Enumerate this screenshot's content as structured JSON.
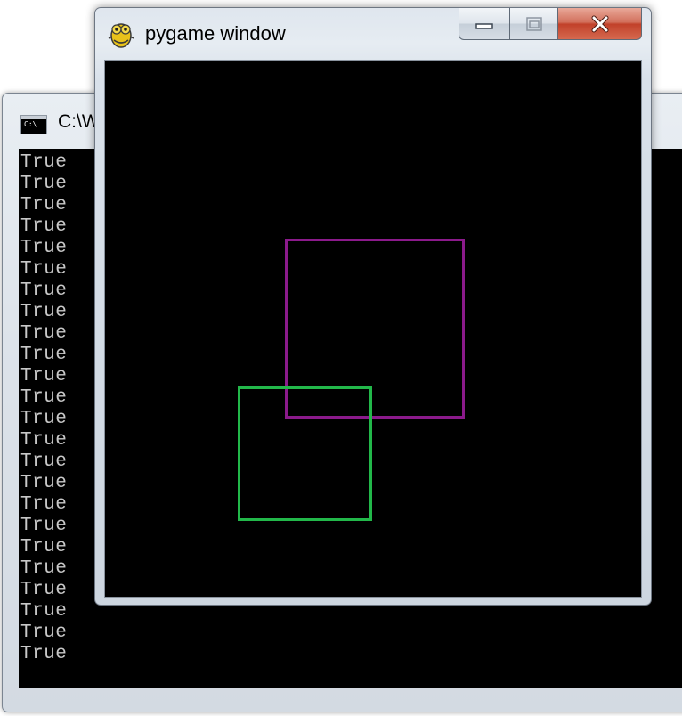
{
  "console": {
    "title": "C:\\W",
    "icon_label": "C:\\",
    "lines": [
      "True",
      "True",
      "True",
      "True",
      "True",
      "True",
      "True",
      "True",
      "True",
      "True",
      "True",
      "True",
      "True",
      "True",
      "True",
      "True",
      "True",
      "True",
      "True",
      "True",
      "True",
      "True",
      "True",
      "True"
    ]
  },
  "pygame": {
    "title": "pygame window",
    "icon": "pygame-snake-icon",
    "buttons": {
      "minimize_icon": "minimize-icon",
      "maximize_icon": "maximize-icon",
      "close_icon": "close-icon"
    },
    "canvas_background": "#000000",
    "shapes": [
      {
        "name": "purple-rectangle",
        "color": "#8b1a8b"
      },
      {
        "name": "green-rectangle",
        "color": "#22b84a"
      }
    ]
  },
  "colors": {
    "close_button": "#c7432d",
    "console_text": "#c8c8c8"
  }
}
